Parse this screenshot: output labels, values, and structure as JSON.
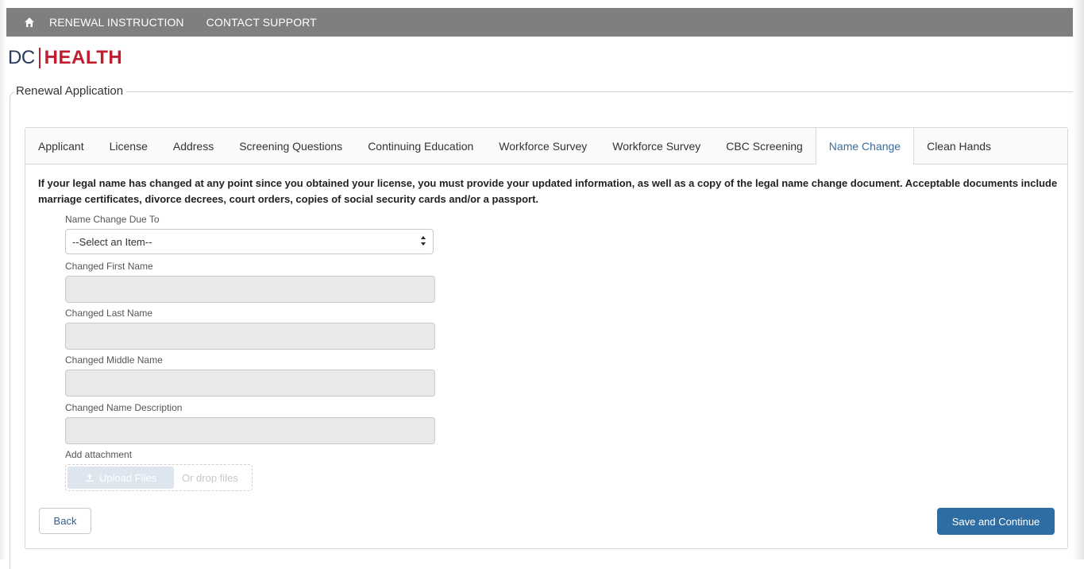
{
  "topnav": {
    "home_icon": "home-icon",
    "links": [
      "RENEWAL INSTRUCTION",
      "CONTACT SUPPORT"
    ]
  },
  "logo": {
    "dc": "DC",
    "health": "HEALTH",
    "brand_color": "#c01e2e"
  },
  "section": {
    "title": "Renewal Application"
  },
  "tabs": [
    {
      "label": "Applicant"
    },
    {
      "label": "License"
    },
    {
      "label": "Address"
    },
    {
      "label": "Screening Questions"
    },
    {
      "label": "Continuing Education"
    },
    {
      "label": "Workforce Survey"
    },
    {
      "label": "Workforce Survey"
    },
    {
      "label": "CBC Screening"
    },
    {
      "label": "Name Change",
      "active": true
    },
    {
      "label": "Clean Hands"
    }
  ],
  "info_text": "If your legal name has changed at any point since you obtained your license, you must provide your updated information, as well as a copy of the legal name change document. Acceptable documents include marriage certificates, divorce decrees, court orders, copies of social security cards and/or a passport.",
  "form": {
    "name_change_due_to": {
      "label": "Name Change Due To",
      "value": "--Select an Item--"
    },
    "first_name": {
      "label": "Changed First Name",
      "value": ""
    },
    "last_name": {
      "label": "Changed Last Name",
      "value": ""
    },
    "middle_name": {
      "label": "Changed Middle Name",
      "value": ""
    },
    "description": {
      "label": "Changed Name Description",
      "value": ""
    },
    "attachment": {
      "label": "Add attachment",
      "upload_label": "Upload Files",
      "drop_label": "Or drop files"
    }
  },
  "buttons": {
    "back": "Back",
    "save": "Save and Continue"
  },
  "colors": {
    "topbar": "#7f7f7f",
    "active_tab": "#3b6e9e",
    "primary_button": "#2e6da4"
  }
}
